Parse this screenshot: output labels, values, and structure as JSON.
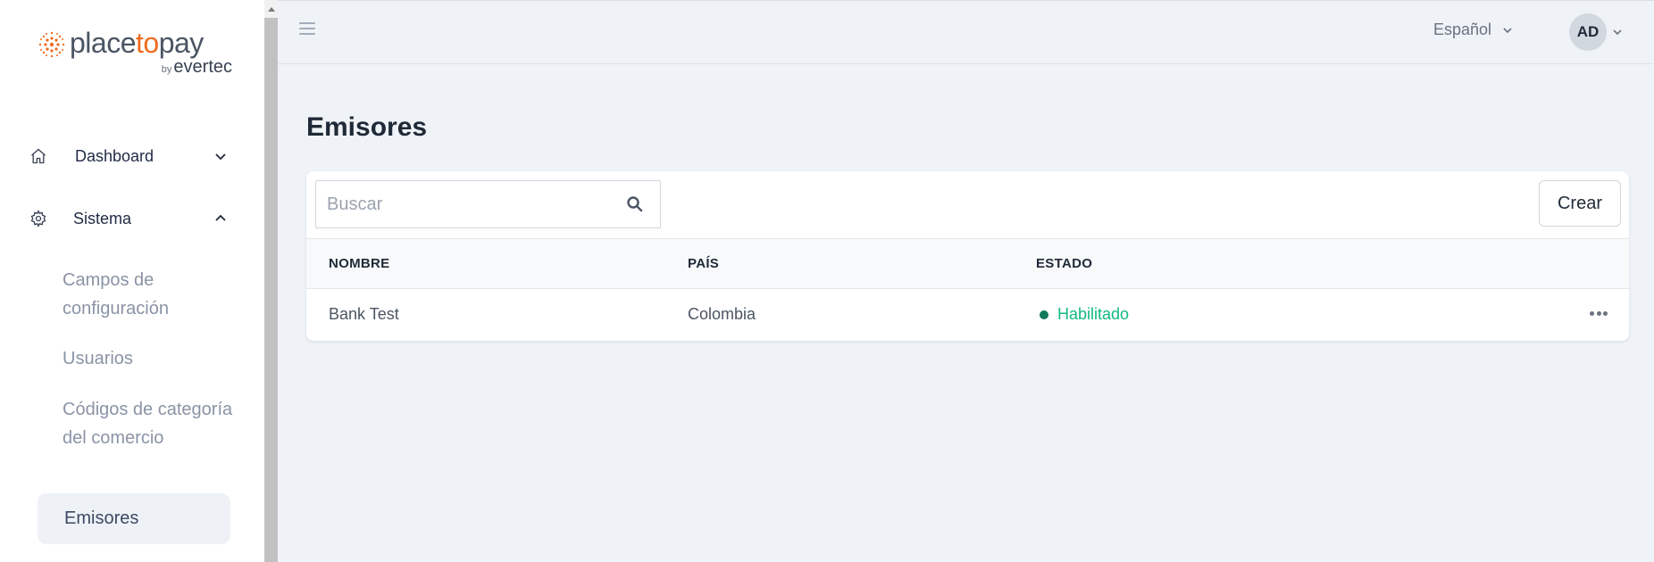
{
  "brand": {
    "logo_part1": "place",
    "logo_part2": "to",
    "logo_part3": "pay",
    "logo_by": "by",
    "logo_sub": "evertec",
    "accent_color": "#f06b1f"
  },
  "sidebar": {
    "items": [
      {
        "label": "Dashboard",
        "icon": "home-icon",
        "expanded": false
      },
      {
        "label": "Sistema",
        "icon": "gear-icon",
        "expanded": true
      }
    ],
    "sub_items": [
      {
        "label": "Campos de configuración"
      },
      {
        "label": "Usuarios"
      },
      {
        "label": "Códigos de categoría del comercio"
      },
      {
        "label": "Emisores",
        "active": true
      }
    ]
  },
  "header": {
    "language": "Español",
    "avatar_initials": "AD"
  },
  "main": {
    "title": "Emisores",
    "search_placeholder": "Buscar",
    "create_label": "Crear",
    "columns": [
      "NOMBRE",
      "PAÍS",
      "ESTADO"
    ],
    "rows": [
      {
        "nombre": "Bank Test",
        "pais": "Colombia",
        "estado": "Habilitado",
        "status_color": "#10b981"
      }
    ]
  }
}
